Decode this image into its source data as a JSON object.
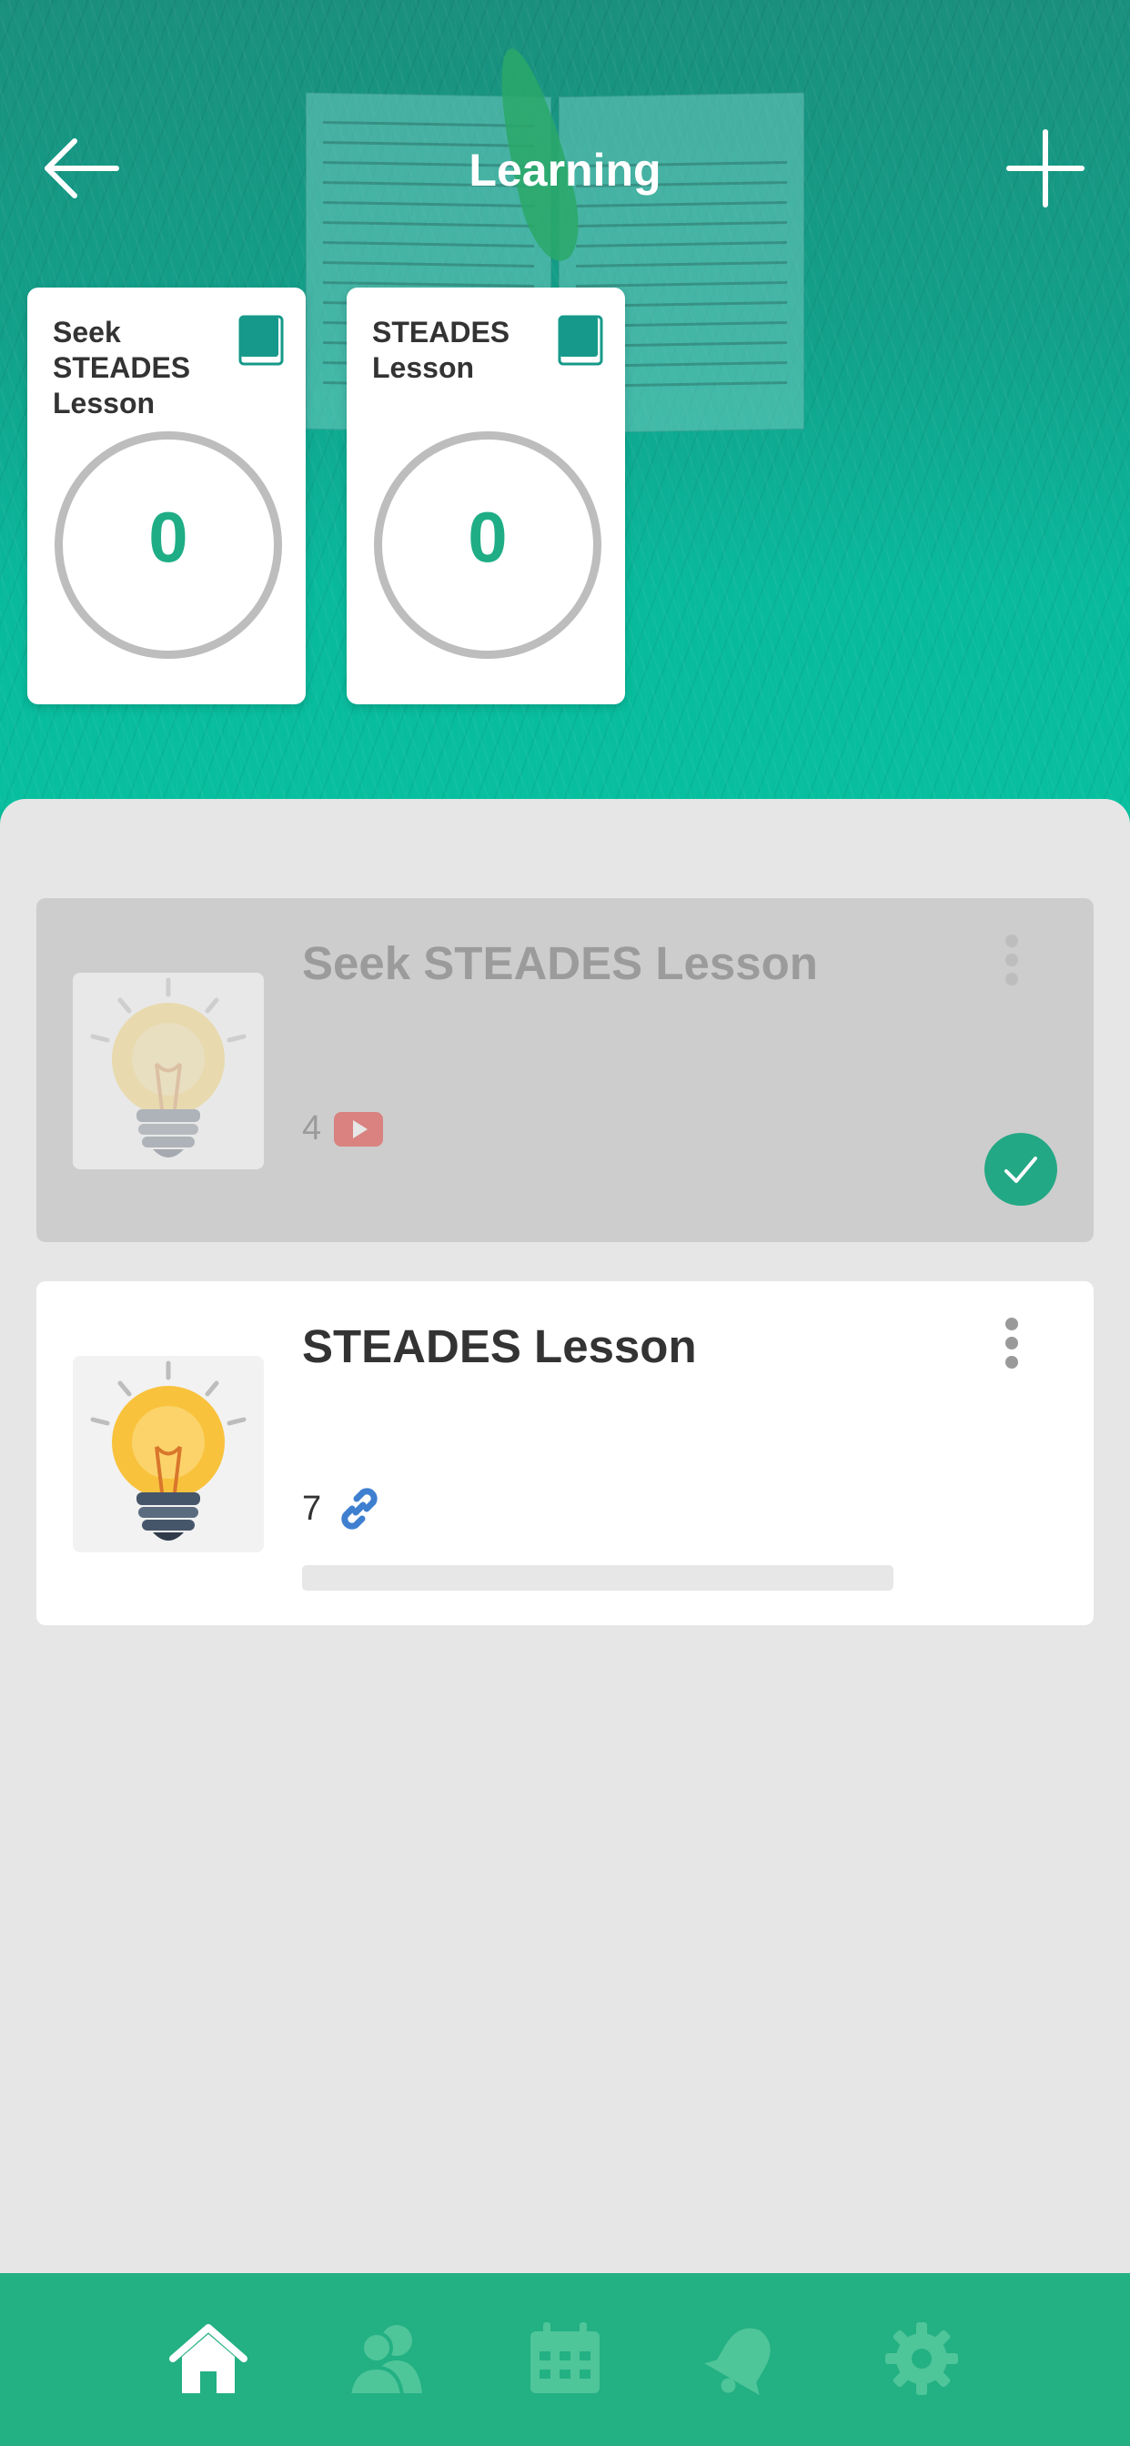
{
  "header": {
    "title": "Learning",
    "back_icon": "arrow-left-icon",
    "add_icon": "plus-icon"
  },
  "summary_cards": [
    {
      "name": "Seek STEADES Lesson",
      "count": "0",
      "icon": "book-icon"
    },
    {
      "name": "STEADES Lesson",
      "count": "0",
      "icon": "book-icon"
    }
  ],
  "lessons": [
    {
      "name": "Seek STEADES Lesson",
      "count": "4",
      "type_icon": "video-icon",
      "status": "completed",
      "thumbnail_icon": "lightbulb-icon"
    },
    {
      "name": "STEADES Lesson",
      "count": "7",
      "type_icon": "link-icon",
      "status": "in-progress",
      "progress": 0,
      "thumbnail_icon": "lightbulb-icon"
    }
  ],
  "bottom_nav": [
    {
      "name": "home",
      "icon": "home-icon",
      "active": true
    },
    {
      "name": "contacts",
      "icon": "users-icon",
      "active": false
    },
    {
      "name": "calendar",
      "icon": "calendar-icon",
      "active": false
    },
    {
      "name": "notifications",
      "icon": "bell-icon",
      "active": false
    },
    {
      "name": "settings",
      "icon": "gear-icon",
      "active": false
    }
  ],
  "colors": {
    "brand_green": "#23b083",
    "accent_teal": "#1fad85",
    "book_icon": "#16998a",
    "video_red": "#e53935",
    "link_blue": "#3f7fd0"
  }
}
